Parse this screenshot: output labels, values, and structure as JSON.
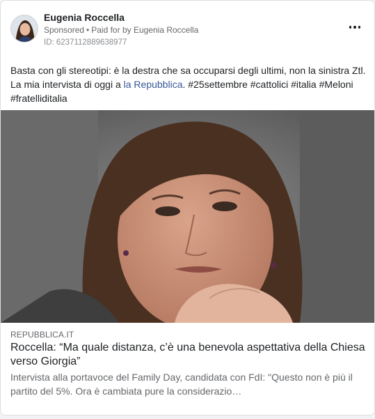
{
  "post": {
    "author": "Eugenia Roccella",
    "sponsored_label": "Sponsored",
    "dot": "•",
    "paid_for_prefix": "Paid for by",
    "paid_for_name": "Eugenia Roccella",
    "ad_id": "ID: 6237112889638977",
    "text_part1": "Basta con gli stereotipi: è la destra che sa occuparsi degli ultimi, non la sinistra Ztl. La mia intervista di oggi a ",
    "text_link": "la Repubblica",
    "text_part2": ". #25settembre #cattolici #italia #Meloni #fratelliditalia"
  },
  "link_preview": {
    "domain": "REPUBBLICA.IT",
    "headline": "Roccella: “Ma quale distanza, c’è una benevola aspettativa della Chiesa verso Giorgia”",
    "description": "Intervista alla portavoce del Family Day, candidata con FdI: \"Questo non è più il partito del 5%. Ora è cambiata pure la considerazio…"
  },
  "icons": {
    "more": "more-options-icon"
  },
  "colors": {
    "link": "#385898",
    "secondary_text": "#65676b",
    "card_background": "#ffffff",
    "page_background": "#f0f2f5"
  }
}
